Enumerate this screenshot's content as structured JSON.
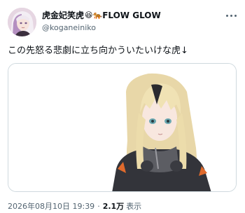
{
  "author": {
    "display_name": "虎金妃笑虎",
    "emoji": "😆🐅",
    "display_name_suffix": "FLOW GLOW",
    "handle": "@koganeiniko"
  },
  "tweet": {
    "text": "この先怒る悲劇に立ち向かういたいけな虎↓"
  },
  "meta": {
    "timestamp": "2026年08月10日 19:39",
    "separator": "·",
    "views_count": "2.1万",
    "views_label": "表示"
  },
  "colors": {
    "text_primary": "#0f1419",
    "text_secondary": "#536471",
    "border": "#cfd9de",
    "background": "#ffffff"
  },
  "icons": {
    "more": "more-horizontal-icon"
  }
}
